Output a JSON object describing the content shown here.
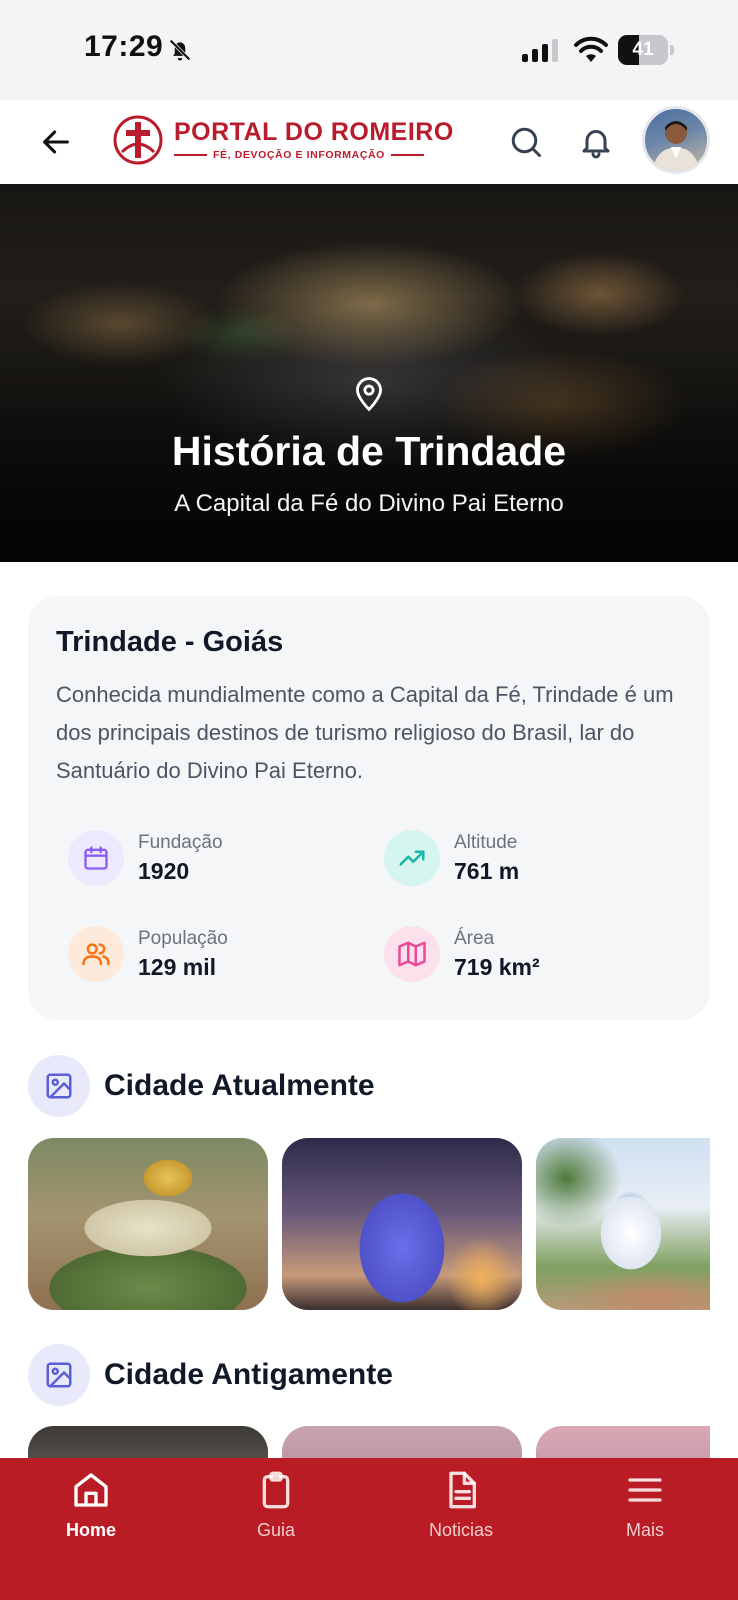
{
  "status_bar": {
    "time": "17:29",
    "battery_level": "41",
    "battery_fraction": 0.41
  },
  "header": {
    "logo_title": "PORTAL DO ROMEIRO",
    "logo_tagline": "FÉ, DEVOÇÃO E INFORMAÇÃO",
    "back_icon": "arrow-left-icon",
    "search_icon": "search-icon",
    "notifications_icon": "bell-icon"
  },
  "hero": {
    "title": "História de Trindade",
    "subtitle": "A Capital da Fé do Divino Pai Eterno",
    "icon": "map-pin-icon"
  },
  "info_card": {
    "title": "Trindade - Goiás",
    "description": "Conhecida mundialmente como a Capital da Fé, Trindade é um dos principais destinos de turismo religioso do Brasil, lar do Santuário do Divino Pai Eterno.",
    "stats": [
      {
        "label": "Fundação",
        "value": "1920",
        "icon": "calendar-icon",
        "color": "#8b5cf6",
        "bg": "#ede9fe"
      },
      {
        "label": "Altitude",
        "value": "761 m",
        "icon": "trending-up-icon",
        "color": "#14b8a6",
        "bg": "#d5f5ef"
      },
      {
        "label": "População",
        "value": "129 mil",
        "icon": "users-icon",
        "color": "#f97316",
        "bg": "#fdeadb"
      },
      {
        "label": "Área",
        "value": "719 km²",
        "icon": "map-icon",
        "color": "#ec4899",
        "bg": "#fce1ec"
      }
    ]
  },
  "sections": {
    "current": {
      "title": "Cidade Atualmente",
      "icon": "image-icon"
    },
    "old": {
      "title": "Cidade Antigamente",
      "icon": "image-icon"
    }
  },
  "bottom_nav": {
    "items": [
      {
        "label": "Home",
        "icon": "home-icon",
        "active": true
      },
      {
        "label": "Guia",
        "icon": "clipboard-icon",
        "active": false
      },
      {
        "label": "Noticias",
        "icon": "document-icon",
        "active": false
      },
      {
        "label": "Mais",
        "icon": "menu-icon",
        "active": false
      }
    ]
  },
  "colors": {
    "brand_red": "#b91c24",
    "section_icon": "#5b5fd6"
  }
}
